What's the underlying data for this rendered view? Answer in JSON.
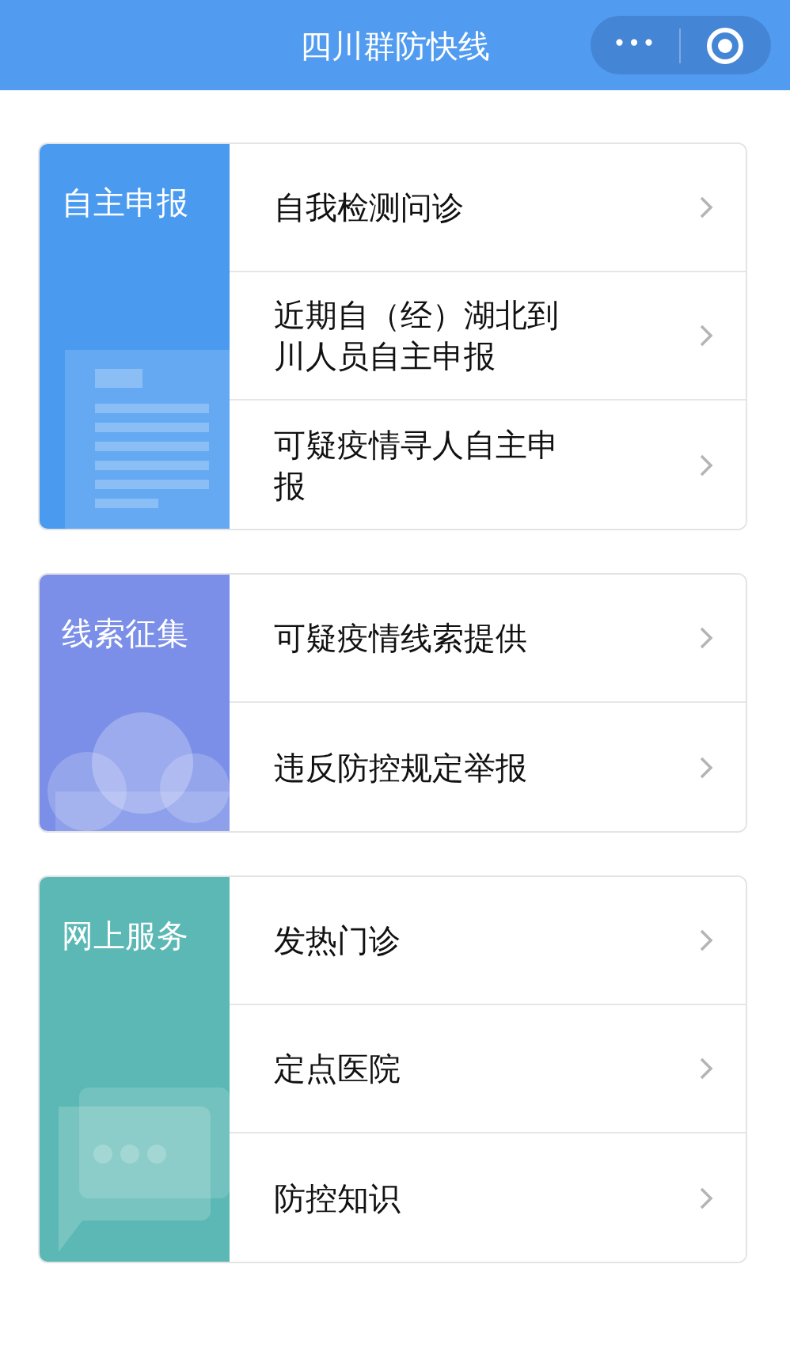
{
  "header": {
    "title": "四川群防快线",
    "more_icon": "•••"
  },
  "sections": [
    {
      "title": "自主申报",
      "color": "#4a9bf0",
      "kind": "document",
      "items": [
        {
          "label": "自我检测问诊"
        },
        {
          "label": "近期自（经）湖北到川人员自主申报"
        },
        {
          "label": "可疑疫情寻人自主申报"
        }
      ]
    },
    {
      "title": "线索征集",
      "color": "#7b8fe8",
      "kind": "cloud",
      "items": [
        {
          "label": "可疑疫情线索提供"
        },
        {
          "label": "违反防控规定举报"
        }
      ]
    },
    {
      "title": "网上服务",
      "color": "#5bb8b4",
      "kind": "chat",
      "items": [
        {
          "label": "发热门诊"
        },
        {
          "label": "定点医院"
        },
        {
          "label": "防控知识"
        }
      ]
    }
  ]
}
